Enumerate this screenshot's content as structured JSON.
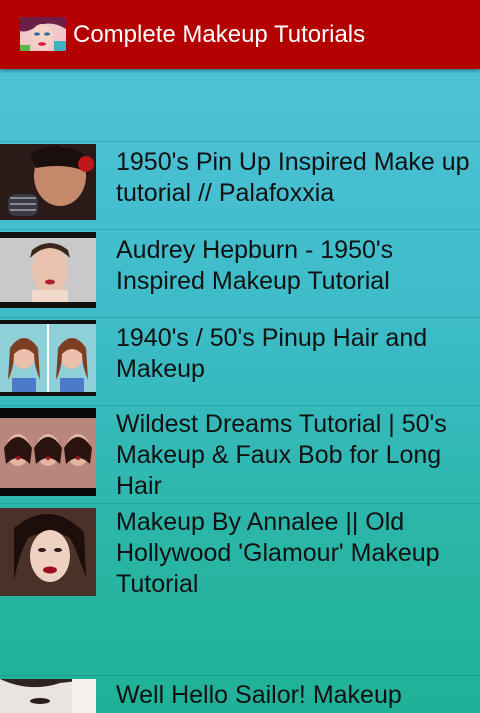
{
  "app": {
    "title": "Complete Makeup Tutorials",
    "icon": "makeup-face-icon",
    "colors": {
      "appbar": "#b50000",
      "background_top": "#52c3db",
      "background_bottom": "#20b298"
    }
  },
  "videos": [
    {
      "title": "1950's Pin Up Inspired Make up tutorial // Palafoxxia",
      "thumbnail": "pinup-makeup-thumbnail"
    },
    {
      "title": "Audrey Hepburn - 1950's Inspired Makeup Tutorial",
      "thumbnail": "audrey-hepburn-thumbnail"
    },
    {
      "title": "1940's / 50's Pinup Hair and Makeup",
      "thumbnail": "pinup-hair-thumbnail"
    },
    {
      "title": "Wildest Dreams Tutorial | 50's Makeup & Faux Bob for Long Hair",
      "thumbnail": "wildest-dreams-thumbnail"
    },
    {
      "title": "Makeup By Annalee || Old Hollywood 'Glamour' Makeup Tutorial",
      "thumbnail": "old-hollywood-thumbnail"
    },
    {
      "title": "Well Hello Sailor! Makeup",
      "thumbnail": "hello-sailor-thumbnail"
    }
  ]
}
